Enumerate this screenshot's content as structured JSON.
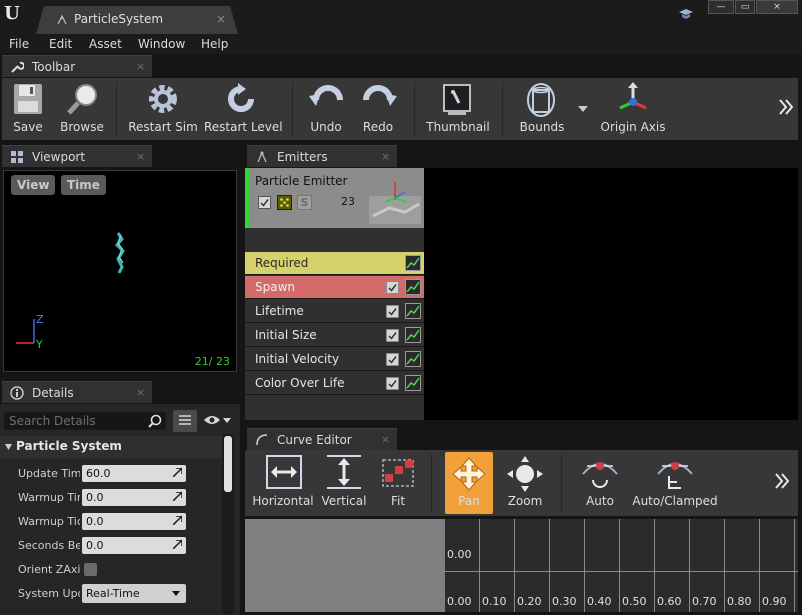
{
  "window": {
    "tab_title": "ParticleSystem",
    "close_glyph": "×",
    "minimize_glyph": "—",
    "maximize_glyph": "▭"
  },
  "menu": [
    "File",
    "Edit",
    "Asset",
    "Window",
    "Help"
  ],
  "toolbar_panel": {
    "title": "Toolbar",
    "buttons": [
      {
        "label": "Save",
        "icon": "save-icon"
      },
      {
        "label": "Browse",
        "icon": "browse-icon"
      },
      {
        "label": "Restart Sim",
        "icon": "gear-icon"
      },
      {
        "label": "Restart Level",
        "icon": "refresh-icon"
      },
      {
        "label": "Undo",
        "icon": "undo-icon"
      },
      {
        "label": "Redo",
        "icon": "redo-icon"
      },
      {
        "label": "Thumbnail",
        "icon": "thumbnail-icon"
      },
      {
        "label": "Bounds",
        "icon": "bounds-icon"
      },
      {
        "label": "Origin Axis",
        "icon": "origin-axis-icon"
      }
    ]
  },
  "viewport": {
    "title": "Viewport",
    "view_label": "View",
    "time_label": "Time",
    "particle_count": "21/ 23",
    "axis_z": "Z",
    "axis_y": "Y"
  },
  "details": {
    "title": "Details",
    "search_placeholder": "Search Details",
    "category": "Particle System",
    "props": [
      {
        "label": "Update Time",
        "value": "60.0"
      },
      {
        "label": "Warmup Time",
        "value": "0.0"
      },
      {
        "label": "Warmup Tick",
        "value": "0.0"
      },
      {
        "label": "Seconds Be",
        "value": "0.0"
      },
      {
        "label": "Orient ZAxis",
        "value": ""
      },
      {
        "label": "System Upd",
        "value": "Real-Time"
      }
    ]
  },
  "emitters": {
    "title": "Emitters",
    "emitter_name": "Particle Emitter",
    "emitter_count": "23",
    "solo_label": "S",
    "modules": [
      {
        "label": "Required",
        "color": "#d6d26a",
        "text_color": "#2a2a2a"
      },
      {
        "label": "Spawn",
        "color": "#d46b6b",
        "text_color": "#f0f0f0"
      },
      {
        "label": "Lifetime",
        "color": "#303030",
        "text_color": "#e6e6e6"
      },
      {
        "label": "Initial Size",
        "color": "#303030",
        "text_color": "#e6e6e6"
      },
      {
        "label": "Initial Velocity",
        "color": "#303030",
        "text_color": "#e6e6e6"
      },
      {
        "label": "Color Over Life",
        "color": "#303030",
        "text_color": "#e6e6e6"
      }
    ]
  },
  "curve_editor": {
    "title": "Curve Editor",
    "buttons": [
      {
        "label": "Horizontal",
        "icon": "fit-horizontal-icon"
      },
      {
        "label": "Vertical",
        "icon": "fit-vertical-icon"
      },
      {
        "label": "Fit",
        "icon": "fit-icon"
      },
      {
        "label": "Pan",
        "icon": "pan-icon"
      },
      {
        "label": "Zoom",
        "icon": "zoom-icon"
      },
      {
        "label": "Auto",
        "icon": "auto-tangent-icon"
      },
      {
        "label": "Auto/Clamped",
        "icon": "auto-clamped-icon"
      }
    ],
    "y_label": "0.00",
    "x_ticks": [
      "0.00",
      "0.10",
      "0.20",
      "0.30",
      "0.40",
      "0.50",
      "0.60",
      "0.70",
      "0.80",
      "0.90"
    ]
  },
  "colors": {
    "accent_orange": "#f2a13a",
    "active_green": "#33d633",
    "required_yellow": "#d6d26a",
    "spawn_red": "#d46b6b"
  }
}
